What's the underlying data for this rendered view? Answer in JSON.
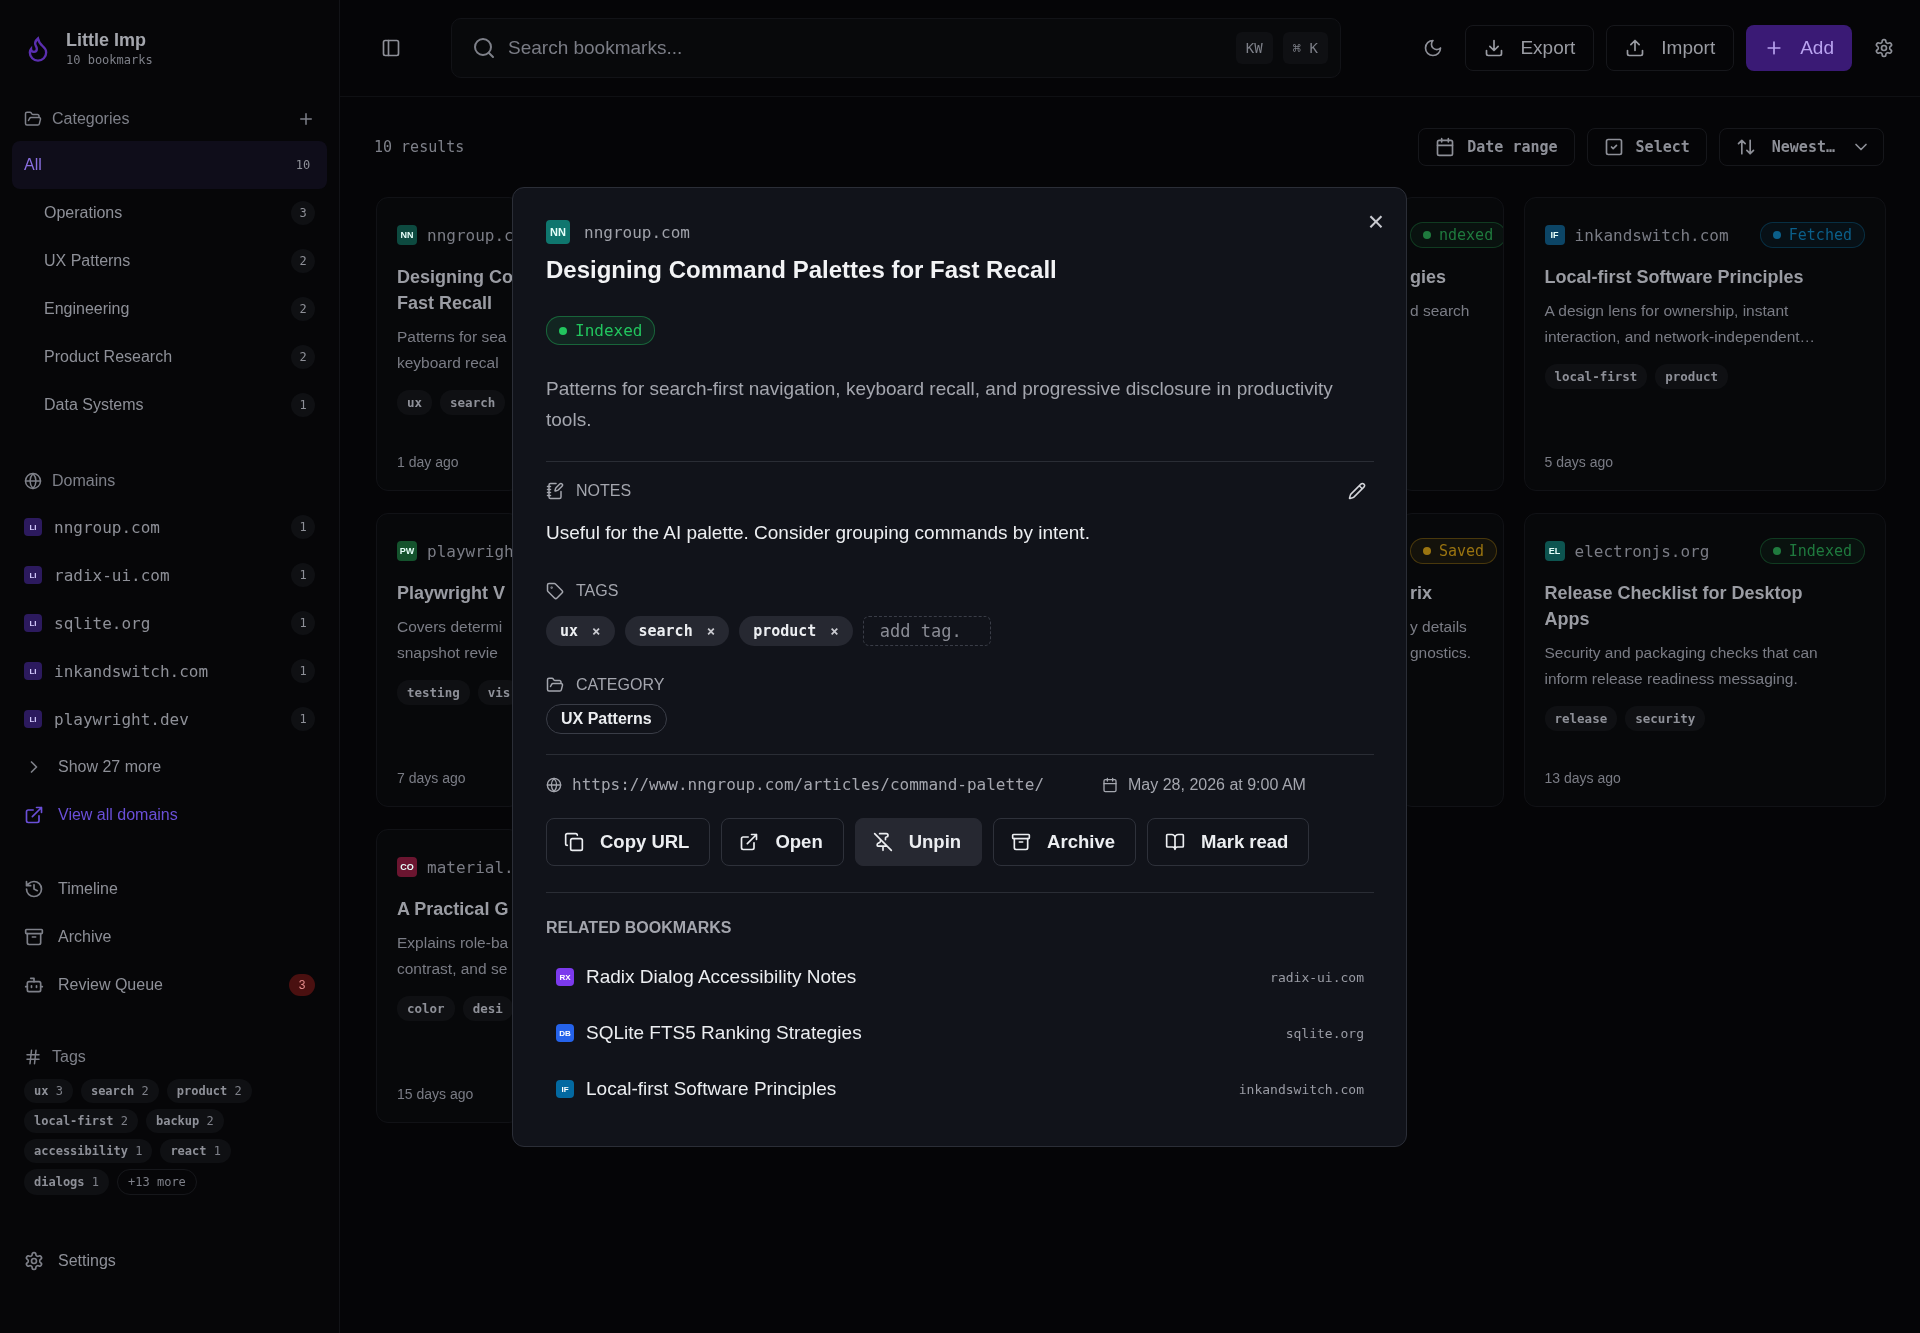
{
  "app": {
    "name": "Little Imp",
    "subtitle": "10 bookmarks"
  },
  "sidebar": {
    "categories": {
      "title": "Categories",
      "items": [
        {
          "label": "All",
          "count": "10",
          "selected": true
        },
        {
          "label": "Operations",
          "count": "3",
          "selected": false
        },
        {
          "label": "UX Patterns",
          "count": "2",
          "selected": false
        },
        {
          "label": "Engineering",
          "count": "2",
          "selected": false
        },
        {
          "label": "Product Research",
          "count": "2",
          "selected": false
        },
        {
          "label": "Data Systems",
          "count": "1",
          "selected": false
        }
      ]
    },
    "domains": {
      "title": "Domains",
      "items": [
        {
          "badge": "LI",
          "label": "nngroup.com",
          "count": "1"
        },
        {
          "badge": "LI",
          "label": "radix-ui.com",
          "count": "1"
        },
        {
          "badge": "LI",
          "label": "sqlite.org",
          "count": "1"
        },
        {
          "badge": "LI",
          "label": "inkandswitch.com",
          "count": "1"
        },
        {
          "badge": "LI",
          "label": "playwright.dev",
          "count": "1"
        }
      ],
      "show_more": "Show 27 more",
      "view_all": "View all domains"
    },
    "nav": [
      {
        "label": "Timeline"
      },
      {
        "label": "Archive"
      },
      {
        "label": "Review Queue",
        "count": "3"
      }
    ],
    "tags": {
      "title": "Tags",
      "items": [
        {
          "label": "ux",
          "count": "3"
        },
        {
          "label": "search",
          "count": "2"
        },
        {
          "label": "product",
          "count": "2"
        },
        {
          "label": "local-first",
          "count": "2"
        },
        {
          "label": "backup",
          "count": "2"
        },
        {
          "label": "accessibility",
          "count": "1"
        },
        {
          "label": "react",
          "count": "1"
        },
        {
          "label": "dialogs",
          "count": "1"
        }
      ],
      "more": "+13 more"
    },
    "settings": "Settings"
  },
  "toolbar": {
    "search": {
      "placeholder": "Search bookmarks...",
      "keys": [
        "KW",
        "⌘ K"
      ]
    },
    "buttons": [
      {
        "label": "Export",
        "kind": "secondary"
      },
      {
        "label": "Import",
        "kind": "secondary"
      },
      {
        "label": "Add",
        "kind": "primary"
      }
    ]
  },
  "results": {
    "count": "10 results",
    "date_range": "Date range",
    "select": "Select",
    "sort": "Newest…"
  },
  "card_rows": [
    [
      {
        "kind": "left_part",
        "badge": {
          "text": "NN",
          "color": "#0d4a40"
        },
        "domain": "nngroup.c",
        "title_lines": [
          "Designing Co",
          "Fast Recall"
        ],
        "description_lines": [
          "Patterns for sea",
          "keyboard recal"
        ],
        "tags": [
          "ux",
          "search"
        ],
        "time": "1 day ago"
      },
      {
        "kind": "right_part",
        "status": {
          "label": "ndexed",
          "color": "#1f7a3e"
        },
        "title_lines": [
          "gies"
        ],
        "description_lines": [
          "d search"
        ]
      },
      {
        "kind": "whole",
        "badge": {
          "text": "IF",
          "color": "#0c4566"
        },
        "domain": "inkandswitch.com",
        "status": {
          "label": "Fetched",
          "color": "#0b5f8a"
        },
        "title_lines": [
          "Local-first Software Principles"
        ],
        "description_lines": [
          "A design lens for ownership, instant",
          "interaction, and network-independent…"
        ],
        "tags": [
          "local-first",
          "product"
        ],
        "time": "5 days ago"
      }
    ],
    [
      {
        "kind": "left_part",
        "badge": {
          "text": "PW",
          "color": "#14532d"
        },
        "domain": "playwrigh",
        "title_lines": [
          "Playwright V"
        ],
        "description_lines": [
          "Covers determi",
          "snapshot revie"
        ],
        "tags": [
          "testing",
          "vis"
        ],
        "time": "7 days ago"
      },
      {
        "kind": "right_part",
        "status": {
          "label": "Saved",
          "color": "#9a7410"
        },
        "title_lines": [
          "rix"
        ],
        "description_lines": [
          "y details",
          "gnostics."
        ]
      },
      {
        "kind": "whole",
        "badge": {
          "text": "EL",
          "color": "#0d5450"
        },
        "domain": "electronjs.org",
        "status": {
          "label": "Indexed",
          "color": "#1f7a3e"
        },
        "title_lines": [
          "Release Checklist for Desktop",
          "Apps"
        ],
        "description_lines": [
          "Security and packaging checks that can",
          "inform release readiness messaging."
        ],
        "tags": [
          "release",
          "security"
        ],
        "time": "13 days ago"
      }
    ],
    [
      {
        "kind": "left_part",
        "badge": {
          "text": "CO",
          "color": "#6b1530"
        },
        "domain": "material.",
        "title_lines": [
          "A Practical G"
        ],
        "description_lines": [
          "Explains role-ba",
          "contrast, and se"
        ],
        "tags": [
          "color",
          "desi"
        ],
        "time": "15 days ago"
      }
    ]
  ],
  "modal": {
    "badge": {
      "text": "NN",
      "color": "#0f766e"
    },
    "domain": "nngroup.com",
    "close": "×",
    "title": "Designing Command Palettes for Fast Recall",
    "status": {
      "label": "Indexed",
      "color": "#22c55e"
    },
    "description": "Patterns for search-first navigation, keyboard recall, and progressive disclosure in productivity tools.",
    "notes": {
      "heading": "NOTES",
      "text": "Useful for the AI palette. Consider grouping commands by intent."
    },
    "tags": {
      "heading": "TAGS",
      "items": [
        "ux",
        "search",
        "product"
      ],
      "remove": "×",
      "placeholder": "add tag."
    },
    "category": {
      "heading": "CATEGORY",
      "value": "UX Patterns"
    },
    "url": "https://www.nngroup.com/articles/command-palette/",
    "date": "May 28, 2026 at 9:00 AM",
    "actions": [
      {
        "label": "Copy URL",
        "pressed": false
      },
      {
        "label": "Open",
        "pressed": false
      },
      {
        "label": "Unpin",
        "pressed": true
      },
      {
        "label": "Archive",
        "pressed": false
      },
      {
        "label": "Mark read",
        "pressed": false
      }
    ],
    "related": {
      "heading": "RELATED BOOKMARKS",
      "items": [
        {
          "badge": "RX",
          "color": "#7c3aed",
          "title": "Radix Dialog Accessibility Notes",
          "domain": "radix-ui.com"
        },
        {
          "badge": "DB",
          "color": "#2563eb",
          "title": "SQLite FTS5 Ranking Strategies",
          "domain": "sqlite.org"
        },
        {
          "badge": "IF",
          "color": "#0369a1",
          "title": "Local-first Software Principles",
          "domain": "inkandswitch.com"
        }
      ]
    }
  }
}
